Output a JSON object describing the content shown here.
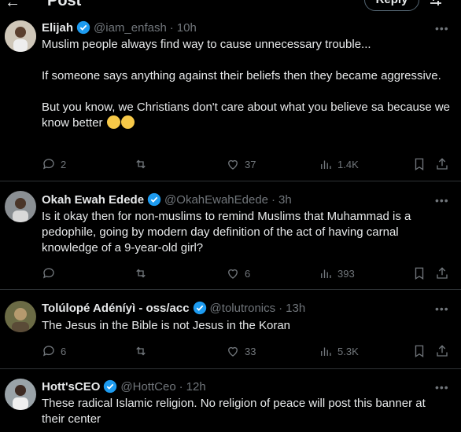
{
  "topbar": {
    "back_icon": "arrow-left-icon",
    "title": "Post",
    "reply_label": "Reply",
    "adjust_icon": "adjust-icon"
  },
  "tweets": [
    {
      "name": "Elijah",
      "handle": "@iam_enfash",
      "time": "10h",
      "paragraphs": [
        "Muslim people always find way to cause unnecessary trouble...",
        "If someone says anything against their beliefs then they became aggressive.",
        "But you know, we Christians don't care about what you believe sa because we know better"
      ],
      "replies": "2",
      "reposts": "",
      "likes": "37",
      "views": "1.4K"
    },
    {
      "name": "Okah Ewah Edede",
      "handle": "@OkahEwahEdede",
      "time": "3h",
      "paragraphs": [
        "Is it okay then for non-muslims to remind Muslims that Muhammad is a pedophile, going by modern day definition of the act of having carnal knowledge of a 9-year-old girl?"
      ],
      "replies": "",
      "reposts": "",
      "likes": "6",
      "views": "393"
    },
    {
      "name": "Tolúlopé Adéníyì - oss/acc",
      "handle": "@tolutronics",
      "time": "13h",
      "paragraphs": [
        "The Jesus in the Bible is not Jesus in the Koran"
      ],
      "replies": "6",
      "reposts": "",
      "likes": "33",
      "views": "5.3K"
    },
    {
      "name": "Hott'sCEO",
      "handle": "@HottCeo",
      "time": "12h",
      "paragraphs": [
        "These radical Islamic religion. No religion of peace will post this banner at their center"
      ]
    }
  ],
  "colors": {
    "background": "#000000",
    "text": "#e7e9ea",
    "muted": "#71767b",
    "verified": "#1d9bf0",
    "divider": "#2f3336"
  }
}
